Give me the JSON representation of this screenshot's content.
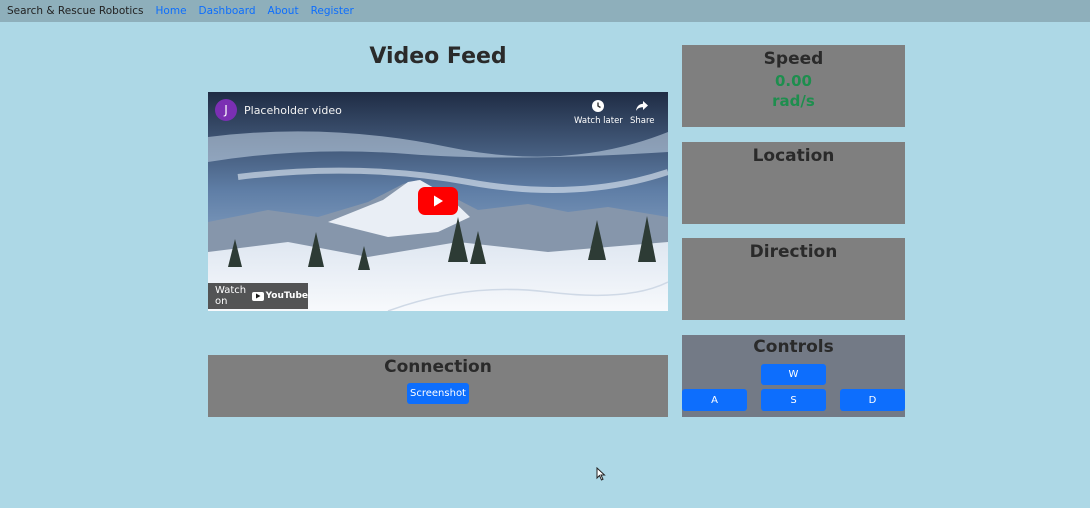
{
  "navbar": {
    "brand": "Search & Rescue Robotics",
    "links": [
      "Home",
      "Dashboard",
      "About",
      "Register"
    ]
  },
  "video": {
    "heading": "Video Feed",
    "channel_initial": "J",
    "title": "Placeholder video",
    "watch_later": "Watch later",
    "share": "Share",
    "watch_on": "Watch on",
    "youtube": "YouTube"
  },
  "speed": {
    "heading": "Speed",
    "value": "0.00",
    "unit": "rad/s"
  },
  "location": {
    "heading": "Location"
  },
  "direction": {
    "heading": "Direction"
  },
  "connection": {
    "heading": "Connection",
    "screenshot_label": "Screenshot"
  },
  "controls": {
    "heading": "Controls",
    "w": "W",
    "a": "A",
    "s": "S",
    "d": "D"
  },
  "colors": {
    "background": "#add8e6",
    "panel": "#7f7f7f",
    "accent": "#0d6efd",
    "speed_value": "#1e8e4e"
  }
}
